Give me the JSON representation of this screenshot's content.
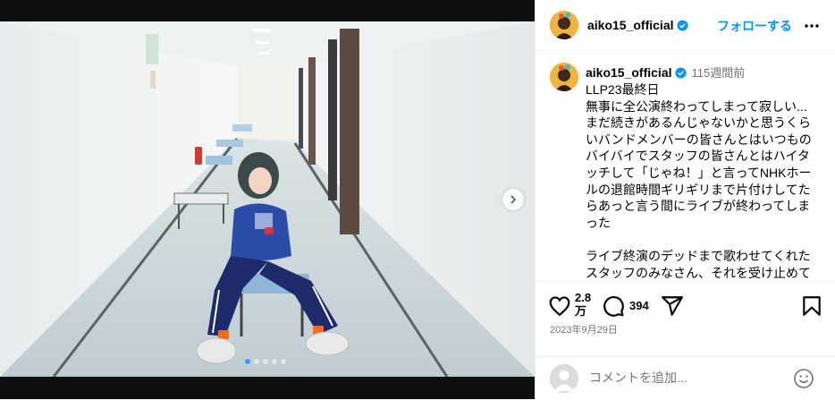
{
  "post": {
    "username": "aiko15_official",
    "follow_label": "フォローする",
    "time_ago": "115週間前",
    "caption": "LLP23最終日\n無事に全公演終わってしまって寂しい...\nまだ続きがあるんじゃないかと思うくらいバンドメンバーの皆さんとはいつものバイバイでスタッフの皆さんとはハイタッチして「じゃね！」と言ってNHKホールの退館時間ギリギリまで片付けしてたらあっと言う間にライブが終わってしまった\n\nライブ終演のデッドまで歌わせてくれたスタッフのみなさん、それを受け止めてくれたお客ちゃん、aikoジャンキー",
    "likes": "2.8\n万",
    "comments": "394",
    "date": "2023年9月29日",
    "comment_placeholder": "コメントを追加...",
    "carousel": {
      "slides": 5,
      "current": 1
    }
  },
  "icons": {
    "verified": "verified-badge-icon",
    "more": "more-horizontal-icon",
    "like": "heart-icon",
    "comment": "comment-bubble-icon",
    "share": "paper-plane-icon",
    "save": "bookmark-icon",
    "emoji": "smiley-face-icon",
    "next": "chevron-right-icon"
  },
  "colors": {
    "accent": "#0095f6",
    "verified": "#0095f6",
    "muted": "#737373",
    "carousel_dot_active": "#3a9cf5",
    "avatar_bg": "#f0b33b"
  }
}
